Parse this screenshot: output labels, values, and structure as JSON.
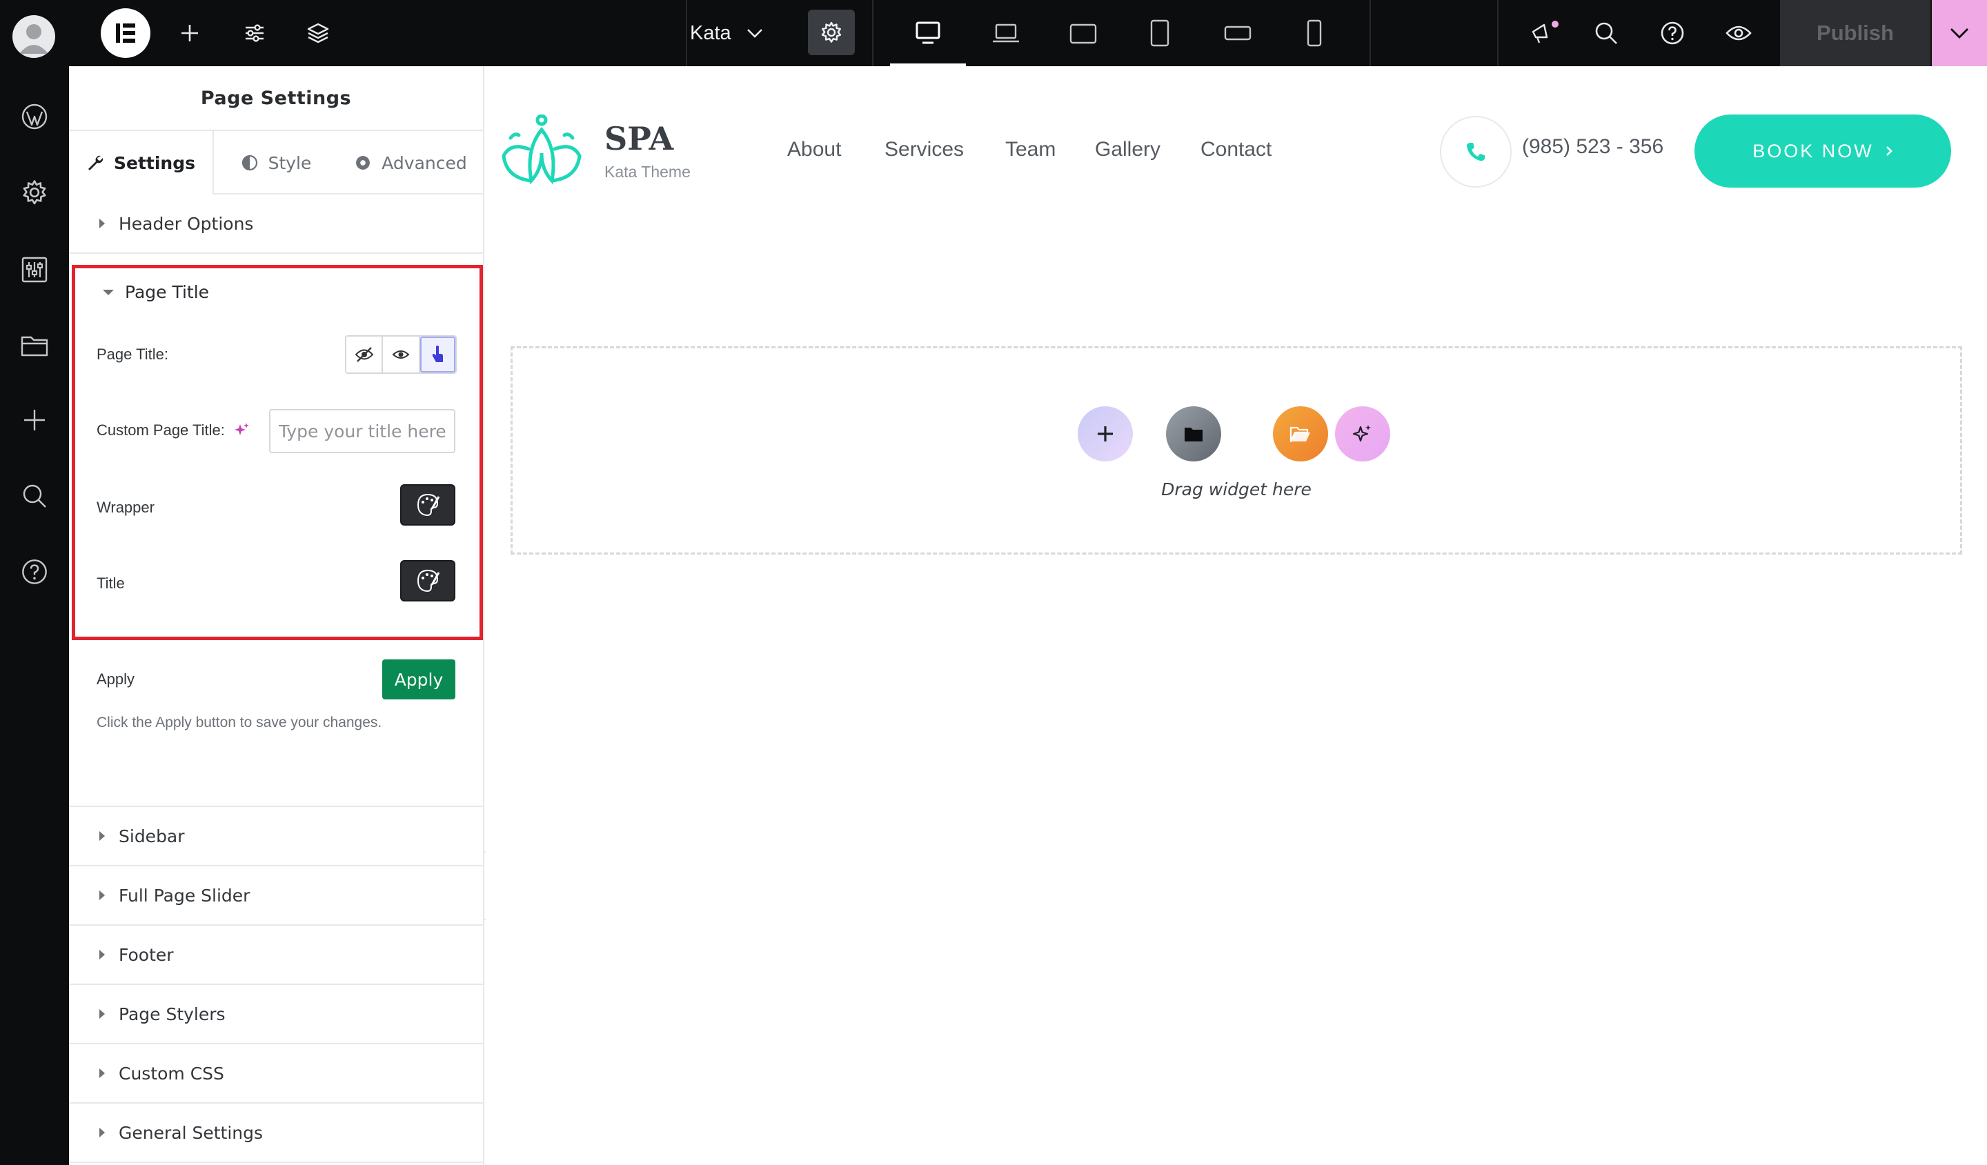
{
  "topbar": {
    "site_selector": "Kata",
    "publish_label": "Publish"
  },
  "panel": {
    "title": "Page Settings",
    "tabs": [
      {
        "label": "Settings"
      },
      {
        "label": "Style"
      },
      {
        "label": "Advanced"
      }
    ],
    "sections_top": [
      {
        "label": "Header Options"
      }
    ],
    "page_title_section": {
      "header": "Page Title",
      "page_title_label": "Page Title:",
      "custom_title_label": "Custom Page Title:",
      "custom_title_placeholder": "Type your title here",
      "wrapper_label": "Wrapper",
      "title_label": "Title"
    },
    "apply": {
      "label": "Apply",
      "button": "Apply",
      "hint": "Click the Apply button to save your changes."
    },
    "sections_bottom": [
      {
        "label": "Sidebar"
      },
      {
        "label": "Full Page Slider"
      },
      {
        "label": "Footer"
      },
      {
        "label": "Page Stylers"
      },
      {
        "label": "Custom CSS"
      },
      {
        "label": "General Settings"
      }
    ]
  },
  "site": {
    "brand": "SPA",
    "brand_sub": "Kata Theme",
    "nav": [
      "About",
      "Services",
      "Team",
      "Gallery",
      "Contact"
    ],
    "phone": "(985) 523 - 356",
    "cta": "BOOK NOW",
    "accent": "#1dd8b8"
  },
  "dropzone": {
    "text": "Drag widget here"
  },
  "colors": {
    "topbar_bg": "#0c0d0e",
    "highlight_border": "#e4222e",
    "apply_green": "#098a52",
    "publish_dropdown": "#f0a9e4"
  }
}
